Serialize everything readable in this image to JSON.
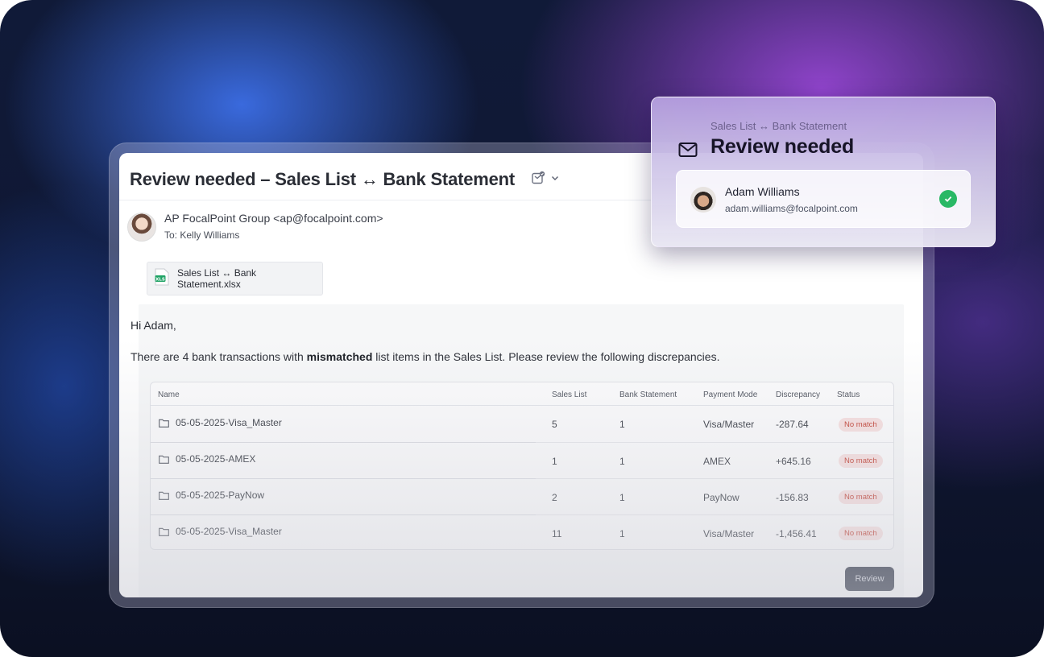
{
  "email": {
    "subject": "Review needed – Sales List ↔ Bank Statement",
    "sender": "AP FocalPoint Group <ap@focalpoint.com>",
    "to_label": "To:",
    "to_name": "Kelly Williams",
    "attachment": {
      "name": "Sales List ↔ Bank Statement.xlsx",
      "icon": "xls-file-icon",
      "icon_text": "XLS"
    },
    "greeting": "Hi Adam,",
    "message": {
      "before": "There are 4 bank transactions with ",
      "bold": "mismatched",
      "after": " list items in the Sales List. Please review the following discrepancies."
    },
    "table": {
      "headers": [
        "Name",
        "Sales List",
        "Bank Statement",
        "Payment Mode",
        "Discrepancy",
        "Status"
      ],
      "rows": [
        {
          "name": "05-05-2025-Visa_Master",
          "sales": "5",
          "bank": "1",
          "mode": "Visa/Master",
          "discrepancy": "-287.64",
          "status": "No match"
        },
        {
          "name": "05-05-2025-AMEX",
          "sales": "1",
          "bank": "1",
          "mode": "AMEX",
          "discrepancy": "+645.16",
          "status": "No match"
        },
        {
          "name": "05-05-2025-PayNow",
          "sales": "2",
          "bank": "1",
          "mode": "PayNow",
          "discrepancy": "-156.83",
          "status": "No match"
        },
        {
          "name": "05-05-2025-Visa_Master",
          "sales": "11",
          "bank": "1",
          "mode": "Visa/Master",
          "discrepancy": "-1,456.41",
          "status": "No match"
        }
      ]
    },
    "review_button": "Review"
  },
  "card": {
    "subtitle": "Sales List ↔ Bank Statement",
    "title": "Review needed",
    "user": {
      "name": "Adam Williams",
      "email": "adam.williams@focalpoint.com"
    }
  },
  "colors": {
    "status_text": "#c0392b",
    "status_bg": "#f6dede",
    "check": "#29b865",
    "button_bg": "#1f2638",
    "excel_green": "#21a366"
  }
}
